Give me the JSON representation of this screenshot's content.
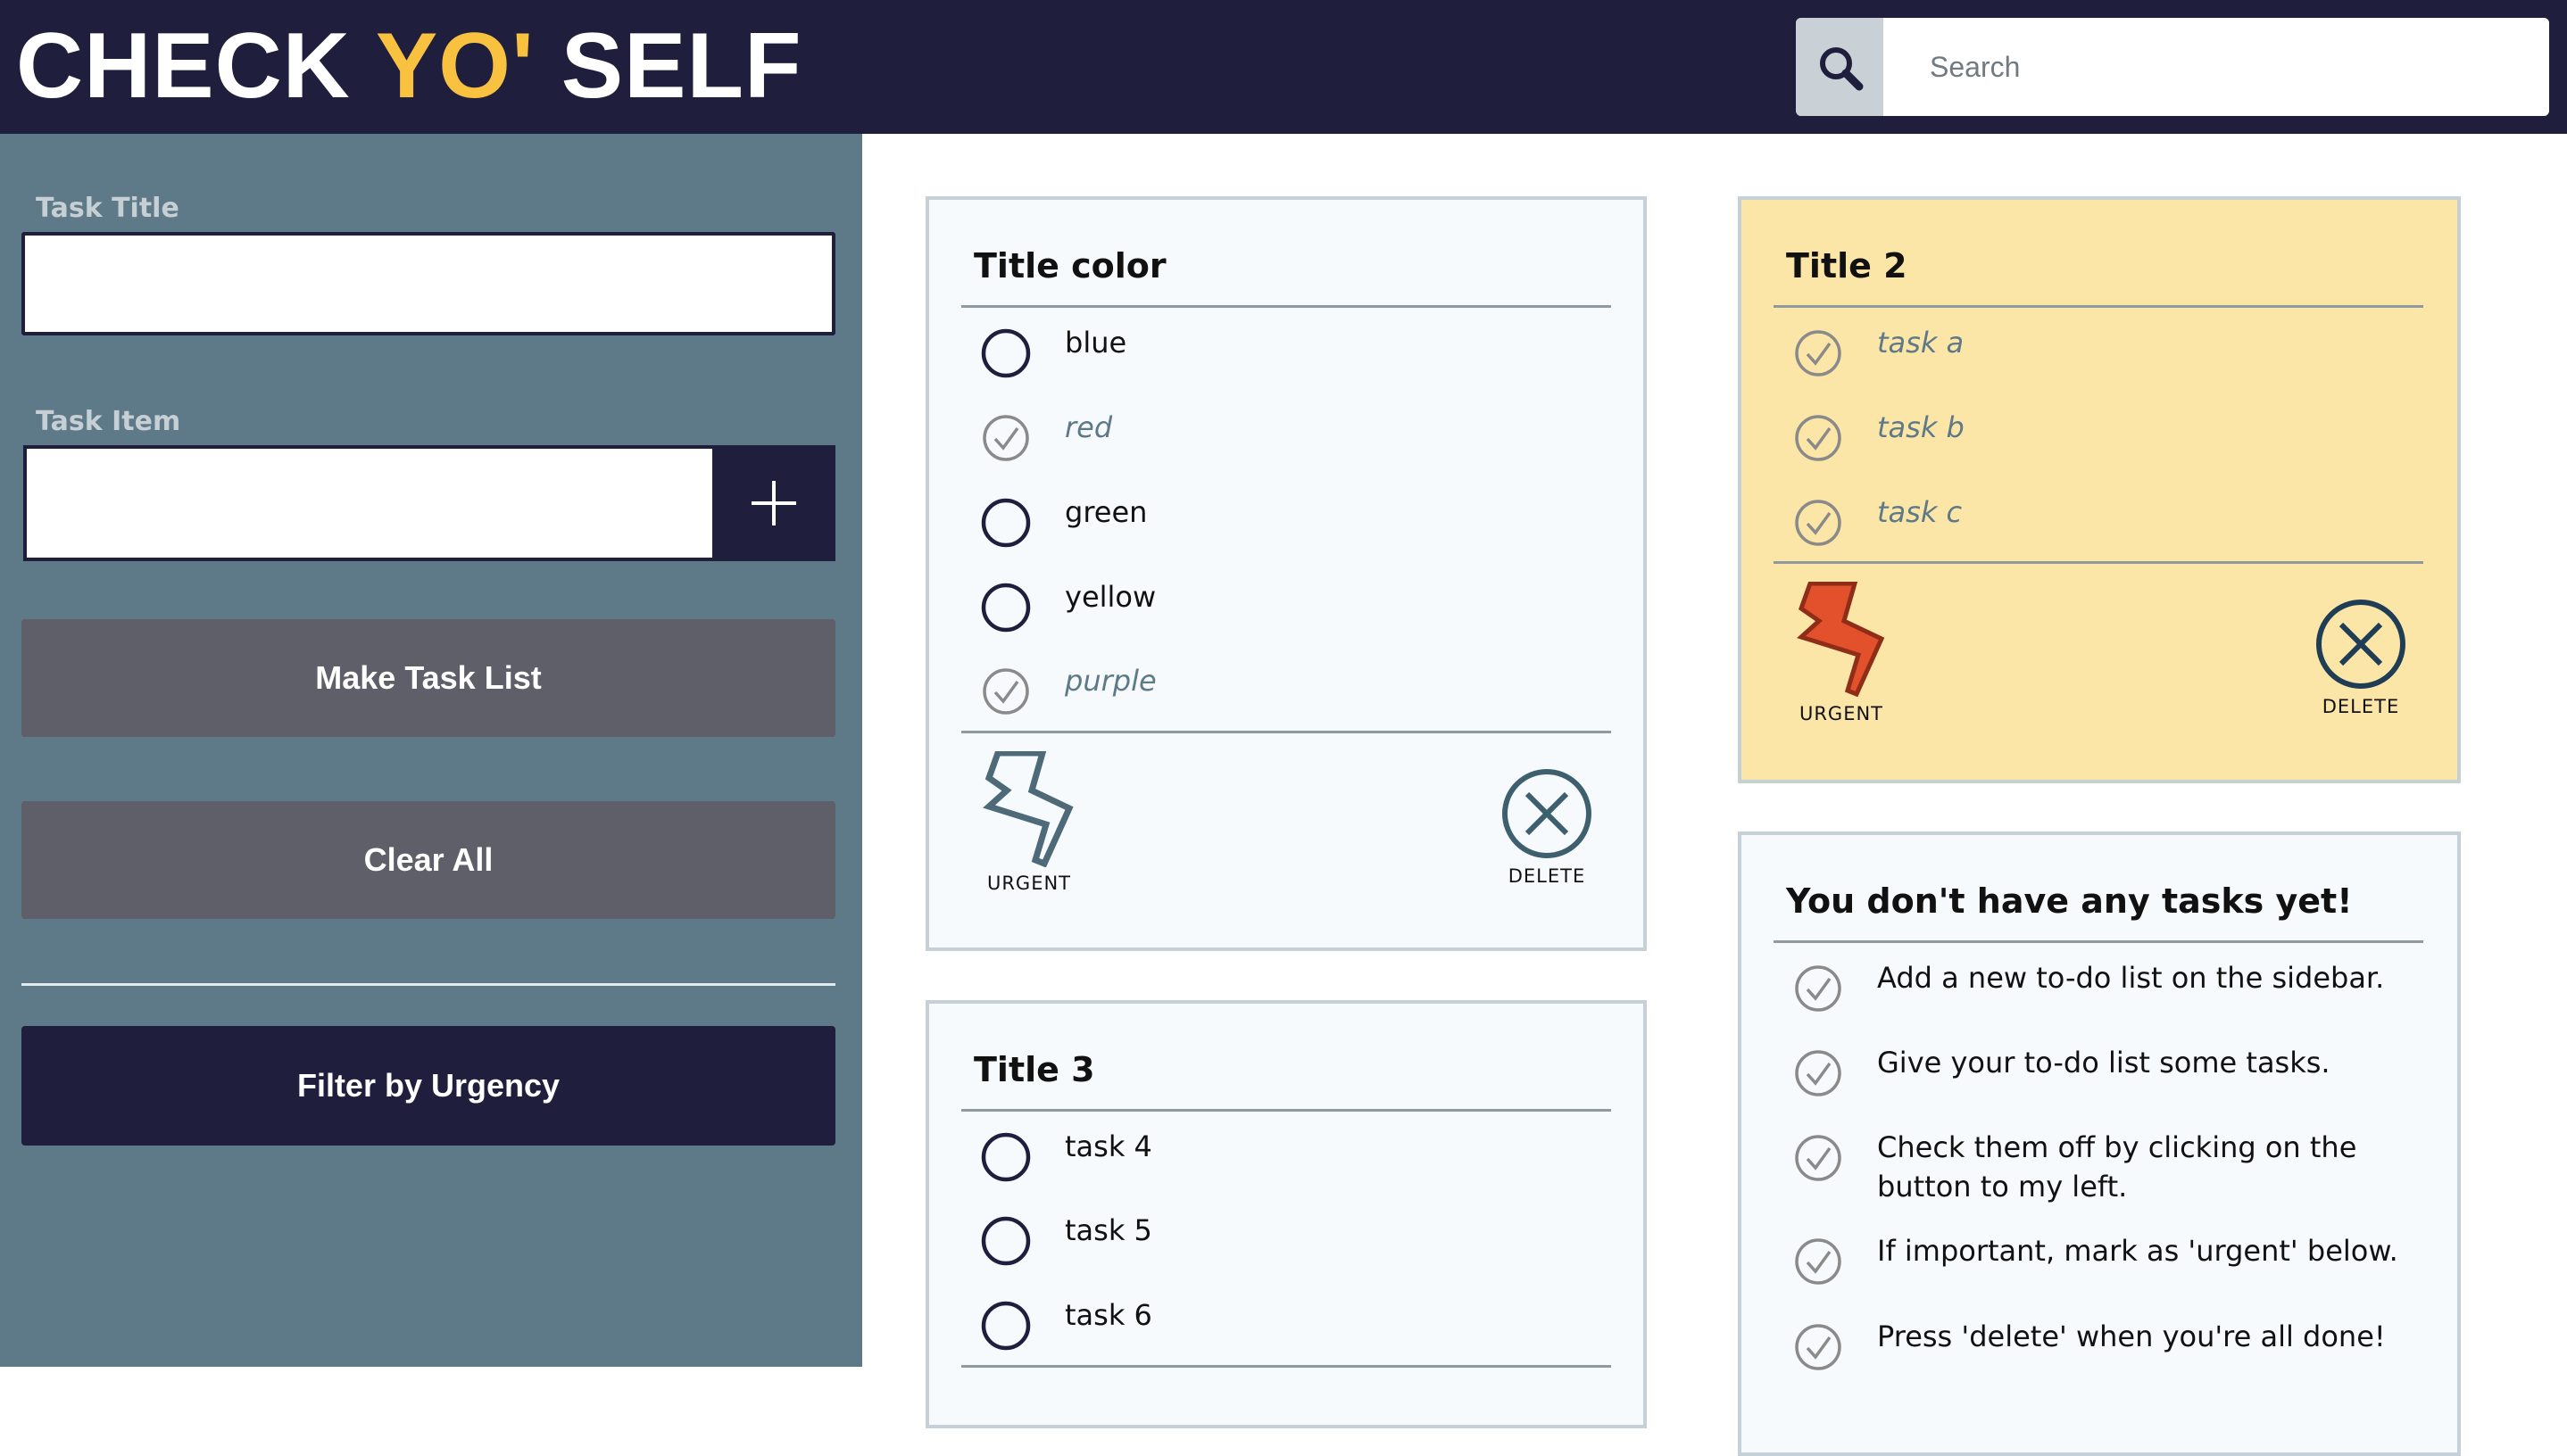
{
  "header": {
    "logo_part1": "CHECK ",
    "logo_accent": "YO'",
    "logo_part2": " SELF",
    "search_placeholder": "Search",
    "search_icon": "magnifier-icon"
  },
  "sidebar": {
    "task_title_label": "Task Title",
    "task_title_value": "",
    "task_item_label": "Task Item",
    "task_item_value": "",
    "add_icon": "plus-icon",
    "make_task_list_label": "Make Task List",
    "clear_all_label": "Clear All",
    "filter_urgency_label": "Filter by Urgency"
  },
  "colors": {
    "navy": "#1f1f3d",
    "accent_yellow": "#f8c240",
    "sidebar": "#5e7987",
    "button_gray": "#5f5f69",
    "urgent_card": "#fbe6a7",
    "card_bg": "#f6fafc",
    "urgent_icon": "#e2502c"
  },
  "cards": [
    {
      "title": "Title color",
      "urgent": false,
      "tasks": [
        {
          "text": "blue",
          "checked": false
        },
        {
          "text": "red",
          "checked": true
        },
        {
          "text": "green",
          "checked": false
        },
        {
          "text": "yellow",
          "checked": false
        },
        {
          "text": "purple",
          "checked": true
        }
      ],
      "urgent_label": "URGENT",
      "delete_label": "DELETE"
    },
    {
      "title": "Title 2",
      "urgent": true,
      "tasks": [
        {
          "text": "task a",
          "checked": true
        },
        {
          "text": "task b",
          "checked": true
        },
        {
          "text": "task c",
          "checked": true
        }
      ],
      "urgent_label": "URGENT",
      "delete_label": "DELETE"
    },
    {
      "title": "Title 3",
      "urgent": false,
      "tasks": [
        {
          "text": "task 4",
          "checked": false
        },
        {
          "text": "task 5",
          "checked": false
        },
        {
          "text": "task 6",
          "checked": false
        }
      ]
    },
    {
      "title": "You don't have any tasks yet!",
      "tasks": [
        {
          "text": "Add a new to-do list on the sidebar.",
          "checked": true
        },
        {
          "text": "Give your to-do list some tasks.",
          "checked": true
        },
        {
          "text": "Check them off by clicking on the button to my left.",
          "checked": true
        },
        {
          "text": "If important, mark as 'urgent' below.",
          "checked": true
        },
        {
          "text": "Press 'delete' when you're all done!",
          "checked": true
        }
      ]
    }
  ]
}
